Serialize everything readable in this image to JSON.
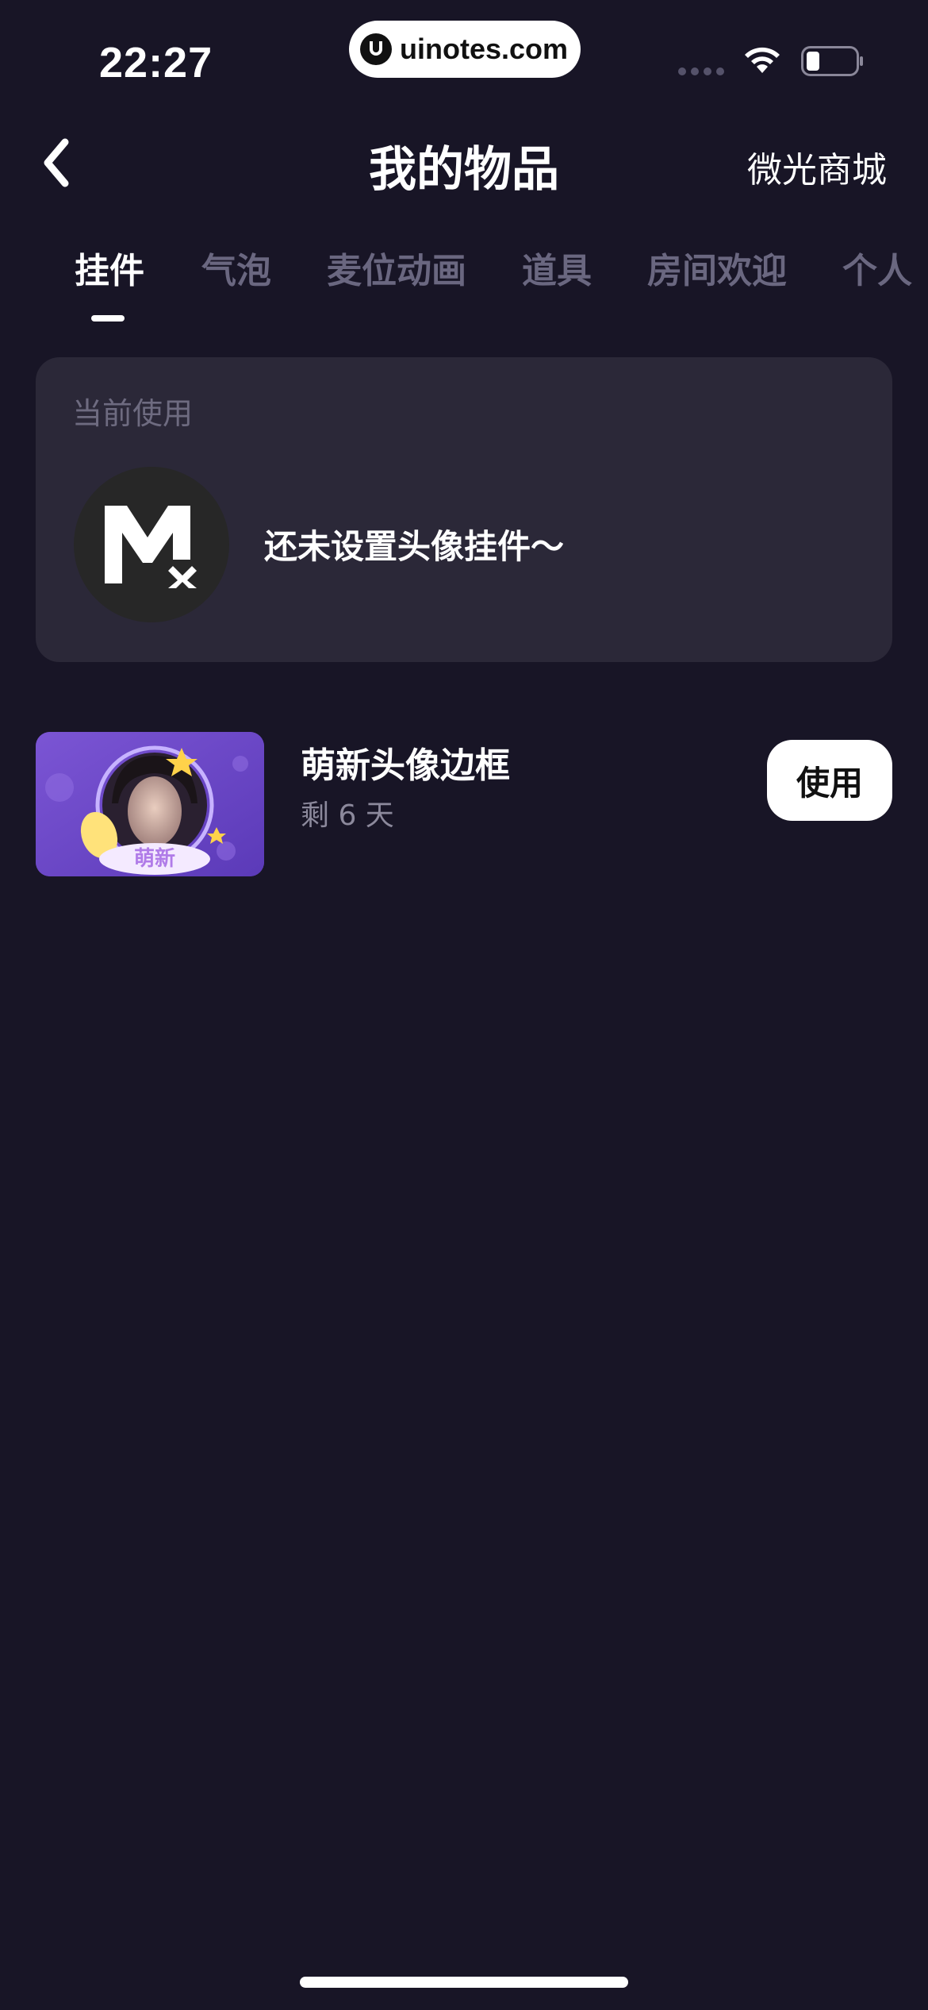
{
  "status_bar": {
    "time": "22:27",
    "watermark": "uinotes.com"
  },
  "nav": {
    "title": "我的物品",
    "right_link": "微光商城"
  },
  "tabs": [
    {
      "label": "挂件",
      "active": true
    },
    {
      "label": "气泡",
      "active": false
    },
    {
      "label": "麦位动画",
      "active": false
    },
    {
      "label": "道具",
      "active": false
    },
    {
      "label": "房间欢迎",
      "active": false
    },
    {
      "label": "个人",
      "active": false
    }
  ],
  "current": {
    "label": "当前使用",
    "empty_message": "还未设置头像挂件～"
  },
  "items": [
    {
      "name": "萌新头像边框",
      "remaining": "剩 6 天",
      "action": "使用",
      "badge_text": "萌新"
    }
  ],
  "colors": {
    "background": "#181526",
    "card": "#2b2838",
    "inactive_tab": "#6a6780",
    "thumb_purple": "#6a48c4"
  }
}
